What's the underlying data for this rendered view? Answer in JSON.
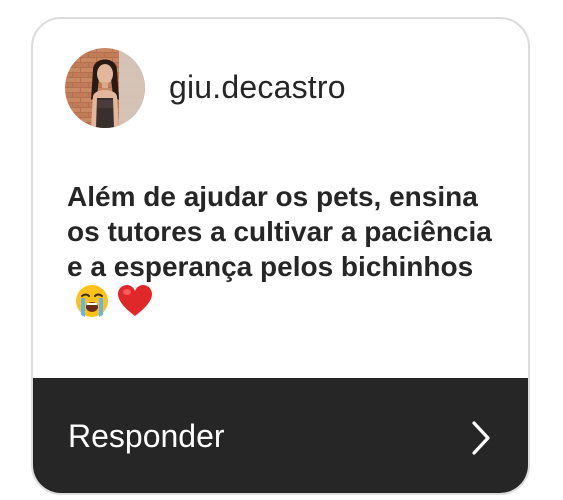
{
  "post": {
    "username": "giu.decastro",
    "avatar_icon": "profile-photo",
    "message": "Além de ajudar os pets, ensina os tutores a cultivar a paciência e a esperança pelos bichinhos",
    "emojis": [
      "loudly-crying-face-icon",
      "red-heart-icon"
    ]
  },
  "footer": {
    "reply_label": "Responder",
    "chevron_icon": "chevron-right-icon"
  },
  "colors": {
    "card_border": "#dcdcdc",
    "text": "#262626",
    "footer_bg": "#262626",
    "footer_text": "#ffffff",
    "heart": "#e0282b"
  }
}
